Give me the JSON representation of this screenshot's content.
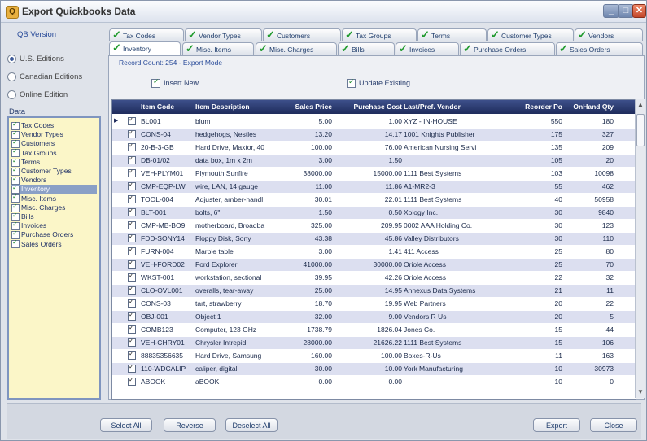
{
  "window": {
    "title": "Export Quickbooks Data"
  },
  "qb_version": {
    "label": "QB Version",
    "options": [
      "U.S. Editions",
      "Canadian Editions",
      "Online Edition"
    ],
    "selected": "U.S. Editions"
  },
  "data_list": {
    "label": "Data",
    "items": [
      "Tax Codes",
      "Vendor Types",
      "Customers",
      "Tax Groups",
      "Terms",
      "Customer Types",
      "Vendors",
      "Inventory",
      "Misc. Items",
      "Misc. Charges",
      "Bills",
      "Invoices",
      "Purchase Orders",
      "Sales Orders"
    ],
    "selected": "Inventory"
  },
  "tabs_row1": [
    "Tax Codes",
    "Vendor Types",
    "Customers",
    "Tax Groups",
    "Terms",
    "Customer Types",
    "Vendors"
  ],
  "tabs_row2": [
    "Inventory",
    "Misc. Items",
    "Misc. Charges",
    "Bills",
    "Invoices",
    "Purchase Orders",
    "Sales Orders"
  ],
  "active_tab": "Inventory",
  "record_info": "Record Count: 254 - Export Mode",
  "options": {
    "insert_new": "Insert New",
    "update_existing": "Update Existing"
  },
  "grid": {
    "columns": [
      "Item Code",
      "Item Description",
      "Sales Price",
      "Purchase Cost",
      "Last/Pref. Vendor",
      "Reorder Po",
      "OnHand Qty"
    ],
    "rows": [
      [
        "BL001",
        "blum",
        "5.00",
        "1.00",
        "XYZ - IN-HOUSE",
        "550",
        "180"
      ],
      [
        "CONS-04",
        "hedgehogs, Nestles",
        "13.20",
        "14.17",
        "1001 Knights Publisher",
        "175",
        "327"
      ],
      [
        "20-B-3-GB",
        "Hard Drive, Maxtor, 40",
        "100.00",
        "76.00",
        "American Nursing Servi",
        "135",
        "209"
      ],
      [
        "DB-01/02",
        "data box, 1m x 2m",
        "3.00",
        "1.50",
        "",
        "105",
        "20"
      ],
      [
        "VEH-PLYM01",
        "Plymouth Sunfire",
        "38000.00",
        "15000.00",
        "1111 Best Systems",
        "103",
        "10098"
      ],
      [
        "CMP-EQP-LW",
        "wire, LAN, 14 gauge",
        "11.00",
        "11.86",
        "A1-MR2-3",
        "55",
        "462"
      ],
      [
        "TOOL-004",
        "Adjuster, amber-handl",
        "30.01",
        "22.01",
        "1111 Best Systems",
        "40",
        "50958"
      ],
      [
        "BLT-001",
        "bolts, 6\"",
        "1.50",
        "0.50",
        "Xology Inc.",
        "30",
        "9840"
      ],
      [
        "CMP-MB-BO9",
        "motherboard, Broadba",
        "325.00",
        "209.95",
        "0002 AAA Holding Co.",
        "30",
        "123"
      ],
      [
        "FDD-SONY14",
        "Floppy Disk, Sony",
        "43.38",
        "45.86",
        "Valley Distributors",
        "30",
        "110"
      ],
      [
        "FURN-004",
        "Marble table",
        "3.00",
        "1.41",
        "411 Access",
        "25",
        "80"
      ],
      [
        "VEH-FORD02",
        "Ford Explorer",
        "41000.00",
        "30000.00",
        "Oriole Access",
        "25",
        "70"
      ],
      [
        "WKST-001",
        "workstation, sectional",
        "39.95",
        "42.26",
        "Oriole Access",
        "22",
        "32"
      ],
      [
        "CLO-OVL001",
        "overalls, tear-away",
        "25.00",
        "14.95",
        "Annexus Data Systems",
        "21",
        "11"
      ],
      [
        "CONS-03",
        "tart, strawberry",
        "18.70",
        "19.95",
        "Web Partners",
        "20",
        "22"
      ],
      [
        "OBJ-001",
        "Object 1",
        "32.00",
        "9.00",
        "Vendors R Us",
        "20",
        "5"
      ],
      [
        "COMB123",
        "Computer, 123 GHz",
        "1738.79",
        "1826.04",
        "Jones Co.",
        "15",
        "44"
      ],
      [
        "VEH-CHRY01",
        "Chrysler Intrepid",
        "28000.00",
        "21626.22",
        "1111 Best Systems",
        "15",
        "106"
      ],
      [
        "88835356635",
        "Hard Drive, Samsung",
        "160.00",
        "100.00",
        "Boxes-R-Us",
        "11",
        "163"
      ],
      [
        "110-WDCALIP",
        "caliper, digital",
        "30.00",
        "10.00",
        "York Manufacturing",
        "10",
        "30973"
      ],
      [
        "ABOOK",
        "aBOOK",
        "0.00",
        "0.00",
        "",
        "10",
        "0"
      ]
    ]
  },
  "buttons": {
    "select_all": "Select All",
    "reverse": "Reverse",
    "deselect_all": "Deselect All",
    "export": "Export",
    "close": "Close"
  },
  "titlebar_buttons": {
    "minimize": "_",
    "maximize": "□",
    "close": "✕"
  },
  "icons": {
    "app": "app-icon",
    "tab_check": "check-icon"
  }
}
